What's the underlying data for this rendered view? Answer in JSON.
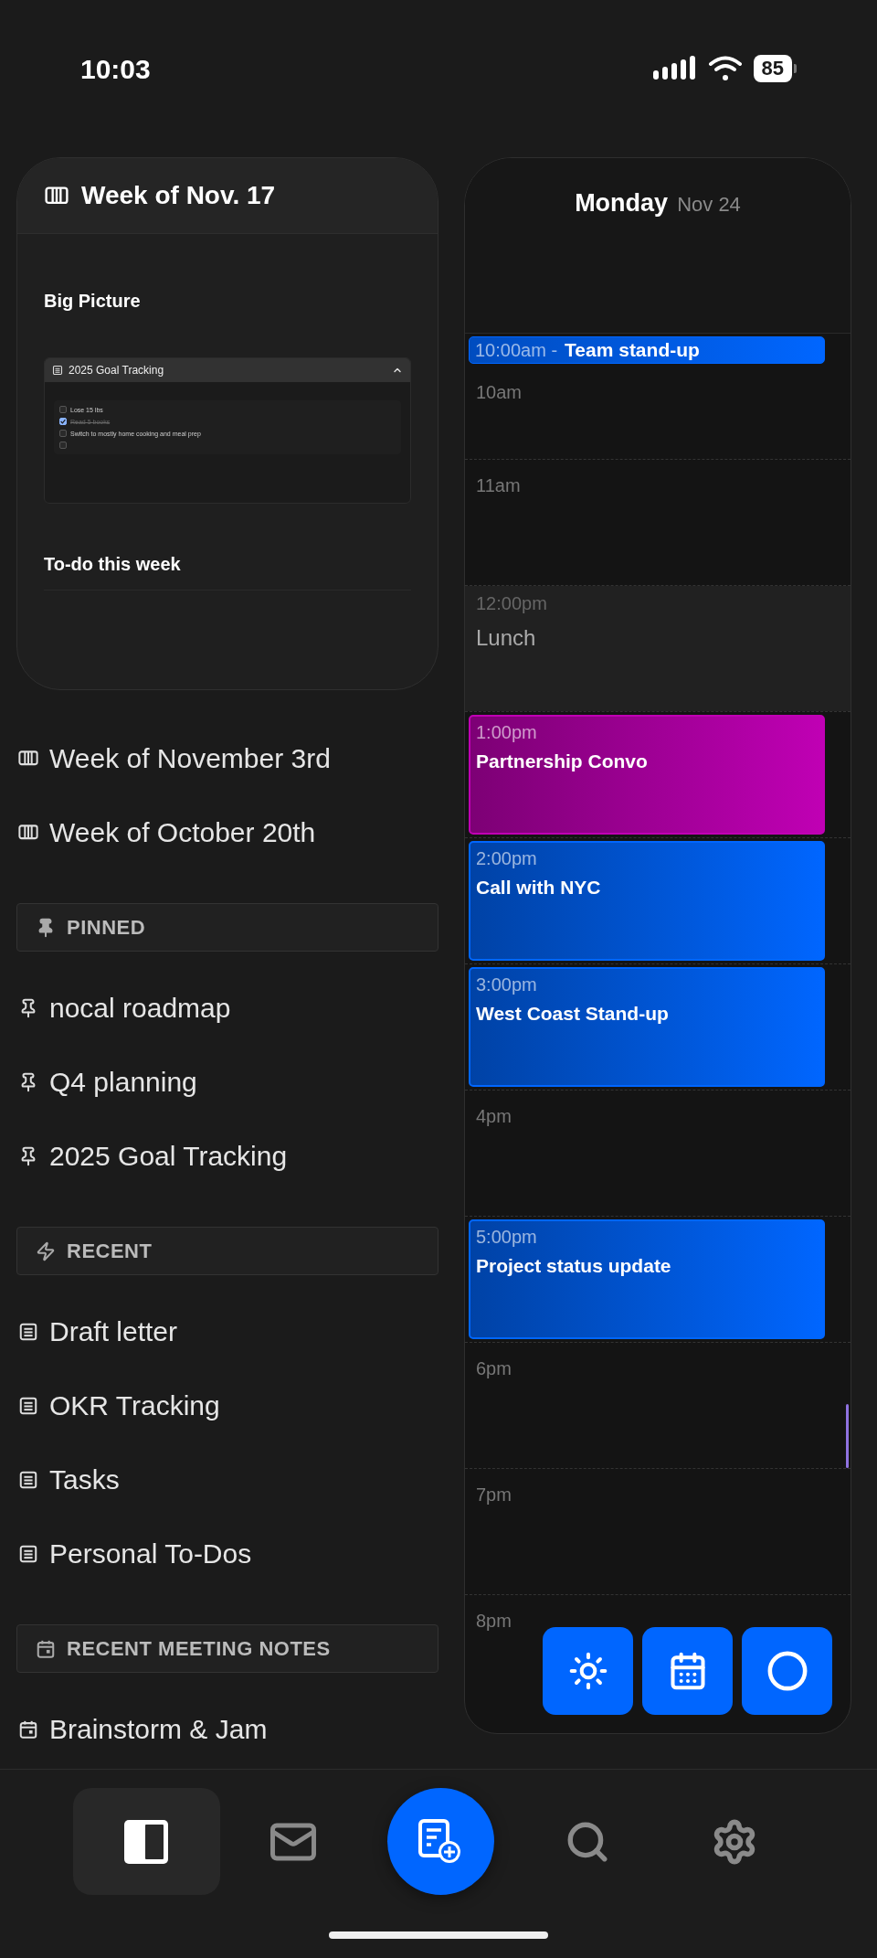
{
  "status_bar": {
    "time": "10:03",
    "battery": "85"
  },
  "week_card": {
    "title": "Week of Nov. 17",
    "sections": [
      {
        "kind": "heading",
        "text": "Big Picture"
      },
      {
        "kind": "embed",
        "title": "2025 Goal Tracking",
        "expanded": true,
        "items": [
          {
            "text": "Lose 15 lbs",
            "checked": false
          },
          {
            "text": "Read 5 books",
            "checked": true
          },
          {
            "text": "Switch to mostly home cooking and meal prep",
            "checked": false
          },
          {
            "checked": false
          }
        ]
      },
      {
        "kind": "heading",
        "text": "To-do this week"
      },
      {
        "kind": "rule"
      }
    ]
  },
  "weeks": [
    {
      "label": "Week of November 3rd"
    },
    {
      "label": "Week of October 20th"
    }
  ],
  "sections": [
    {
      "kind": "pinned",
      "title": "PINNED",
      "items": [
        "nocal roadmap",
        "Q4 planning",
        "2025 Goal Tracking"
      ]
    },
    {
      "kind": "recent",
      "title": "RECENT",
      "items": [
        "Draft letter",
        "OKR Tracking",
        "Tasks",
        "Personal To-Dos"
      ]
    },
    {
      "kind": "meetings",
      "title": "RECENT MEETING NOTES",
      "items": [
        "Brainstorm & Jam"
      ]
    }
  ],
  "calendar": {
    "day": "Monday",
    "date": "Nov 24",
    "hours": [
      {
        "label": "10am",
        "event": {
          "kind": "compact",
          "time": "10:00am -",
          "title": "Team stand-up",
          "color": "#0066ff"
        }
      },
      {
        "label": "11am"
      },
      {
        "event": {
          "kind": "block",
          "time": "12:00pm",
          "title": "Lunch"
        }
      },
      {
        "event": {
          "kind": "card",
          "time": "1:00pm",
          "title": "Partnership Convo",
          "color": "#c000b4"
        }
      },
      {
        "event": {
          "kind": "card",
          "time": "2:00pm",
          "title": "Call with NYC",
          "color": "#0066ff"
        }
      },
      {
        "event": {
          "kind": "card",
          "time": "3:00pm",
          "title": "West Coast Stand-up",
          "color": "#0066ff"
        }
      },
      {
        "label": "4pm"
      },
      {
        "event": {
          "kind": "card",
          "time": "5:00pm",
          "title": "Project status update",
          "color": "#0066ff"
        }
      },
      {
        "label": "6pm"
      },
      {
        "label": "7pm"
      },
      {
        "label": "8pm"
      }
    ],
    "actions": [
      {
        "kind": "sun"
      },
      {
        "kind": "calendar"
      },
      {
        "kind": "circle"
      }
    ]
  },
  "tab_bar": [
    {
      "kind": "sidebar",
      "selected": true
    },
    {
      "kind": "mail",
      "selected": false
    },
    {
      "kind": "compose",
      "selected": false
    },
    {
      "kind": "search",
      "selected": false
    },
    {
      "kind": "settings",
      "selected": false
    }
  ]
}
